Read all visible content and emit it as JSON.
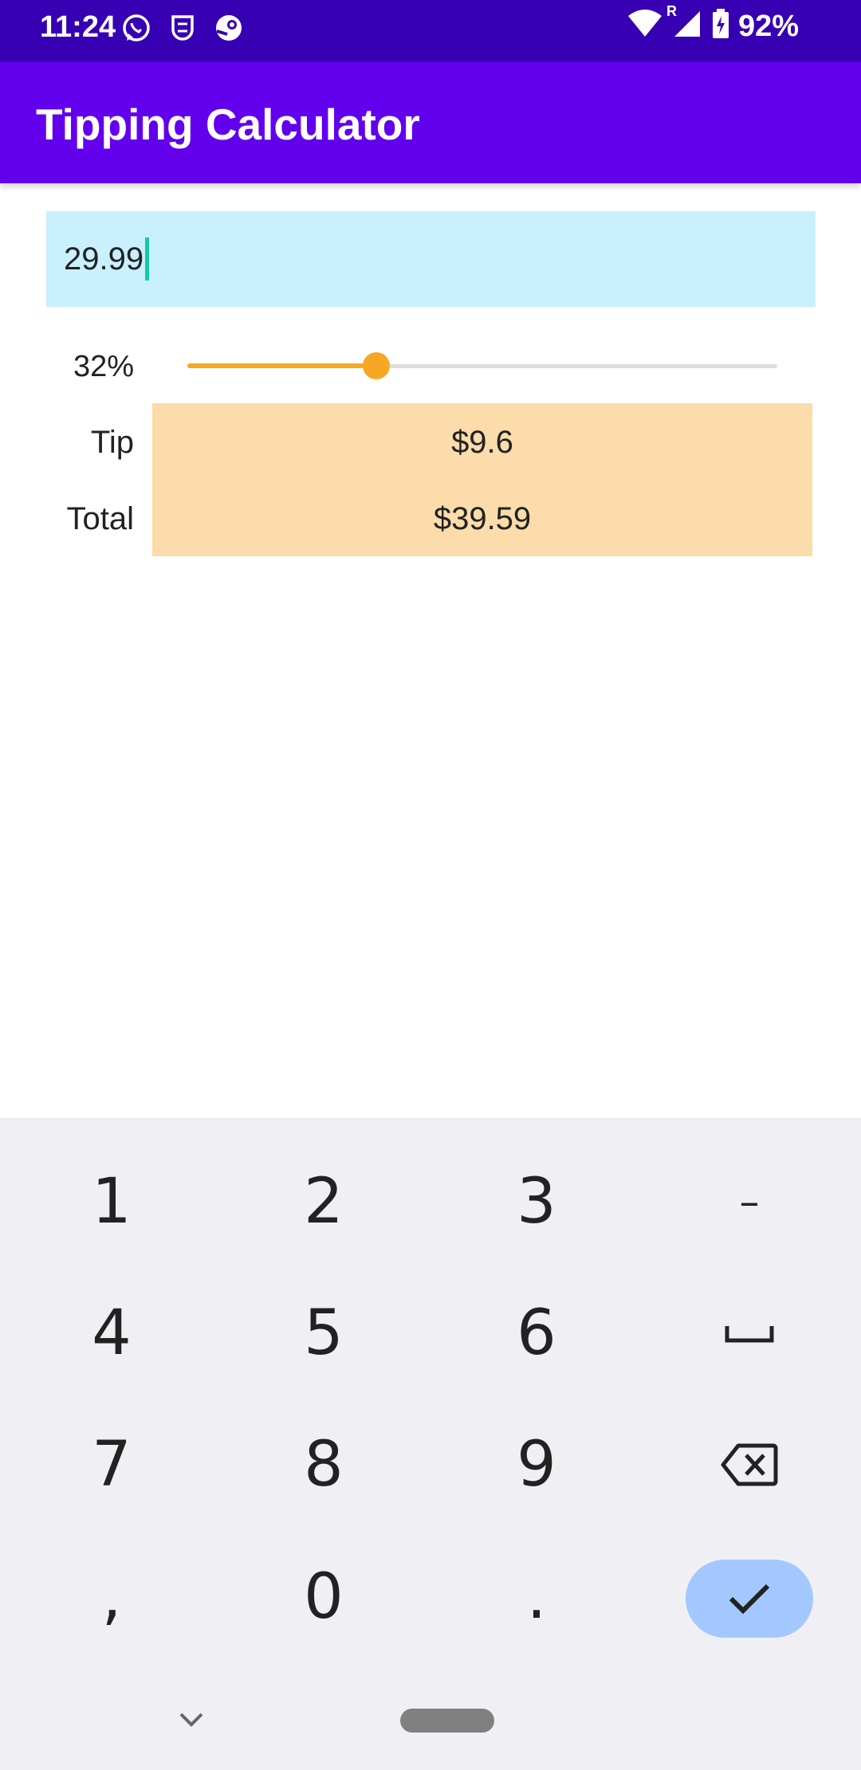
{
  "status_bar": {
    "time": "11:24",
    "app_icons": [
      "whatsapp-icon",
      "mask-notification-icon",
      "steam-icon"
    ],
    "network_indicator": "R",
    "battery_percent": "92%",
    "background": "#3700b3"
  },
  "app_bar": {
    "title": "Tipping Calculator",
    "background": "#6200ee"
  },
  "bill_input": {
    "value": "29.99",
    "background": "#c8f1fd"
  },
  "tip_slider": {
    "label": "32%",
    "value_percent": 32,
    "accent": "#f6a825"
  },
  "results": {
    "tip_label": "Tip",
    "tip_value": "$9.6",
    "total_label": "Total",
    "total_value": "$39.59",
    "background": "#fcdcab"
  },
  "keyboard": {
    "keys": [
      "1",
      "2",
      "3",
      "–",
      "4",
      "5",
      "6",
      "space-icon",
      "7",
      "8",
      "9",
      "backspace-icon",
      ",",
      "0",
      ".",
      "check-icon"
    ],
    "done_key_color": "#a3c8ff"
  },
  "navigation": {
    "icons": [
      "chevron-down-icon",
      "home-pill"
    ]
  }
}
